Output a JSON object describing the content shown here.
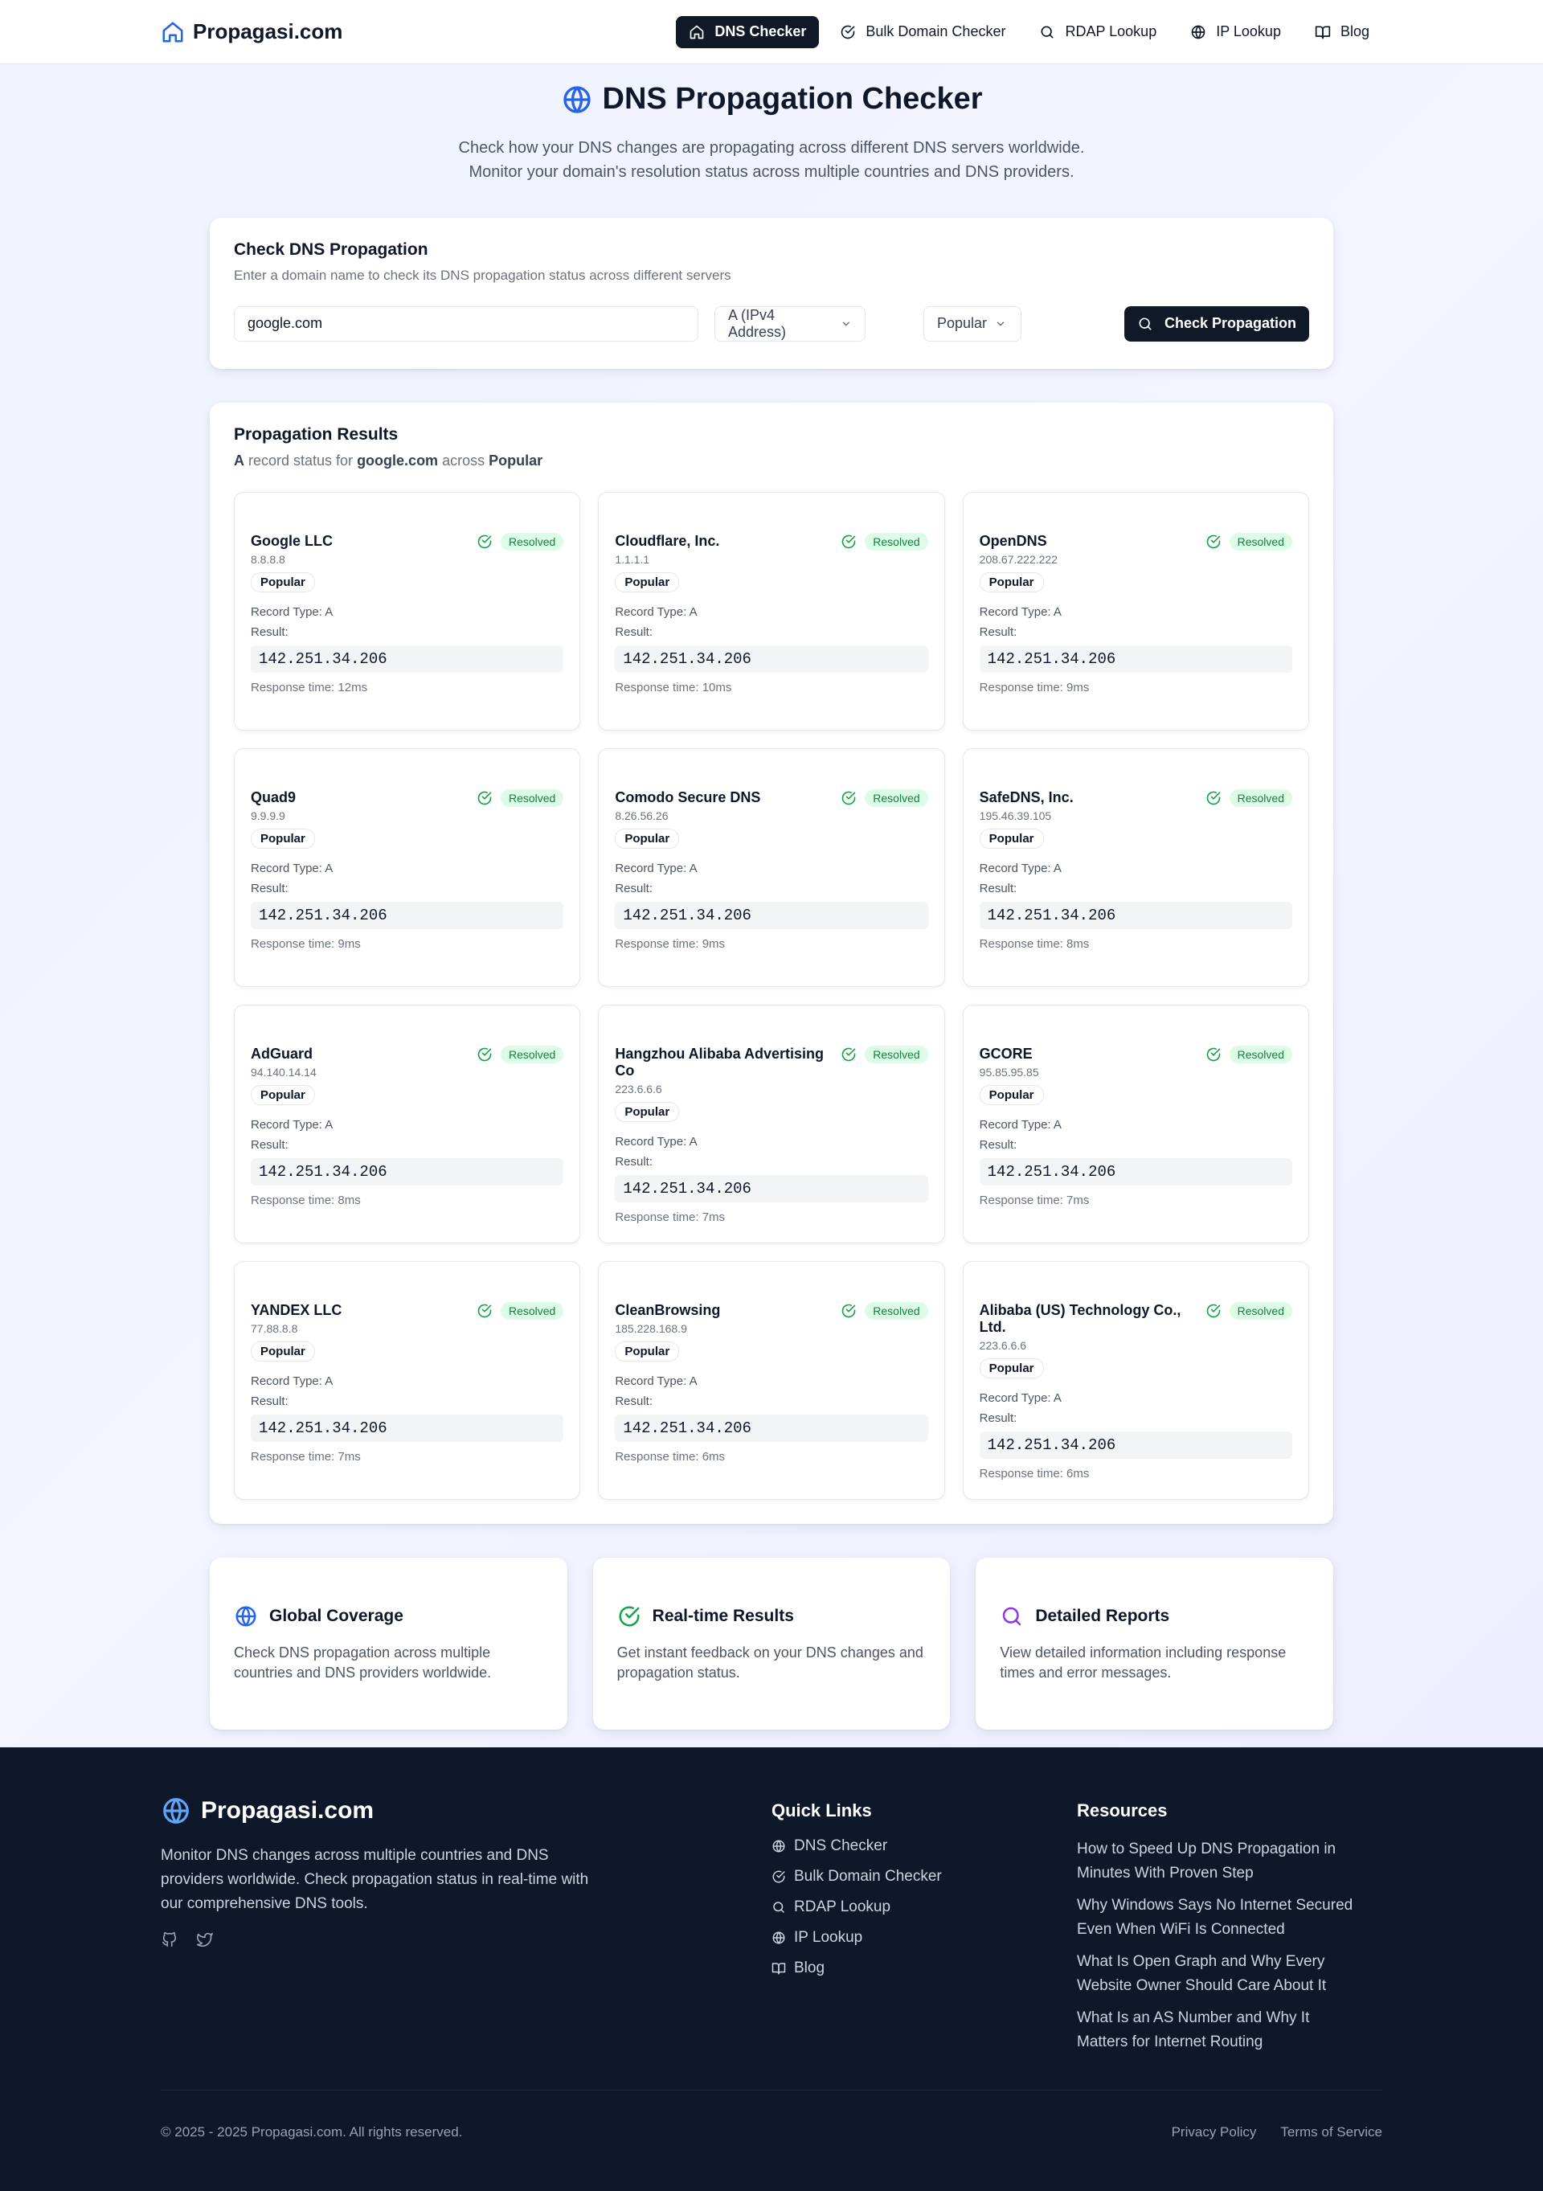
{
  "brand": {
    "name": "Propagasi.com"
  },
  "nav": {
    "items": [
      {
        "label": "DNS Checker",
        "icon": "home-icon",
        "active": true
      },
      {
        "label": "Bulk Domain Checker",
        "icon": "check-circle-icon"
      },
      {
        "label": "RDAP Lookup",
        "icon": "search-icon"
      },
      {
        "label": "IP Lookup",
        "icon": "globe-icon"
      },
      {
        "label": "Blog",
        "icon": "book-icon"
      }
    ]
  },
  "hero": {
    "title": "DNS Propagation Checker",
    "subtitle_line1": "Check how your DNS changes are propagating across different DNS servers worldwide.",
    "subtitle_line2": "Monitor your domain's resolution status across multiple countries and DNS providers."
  },
  "check": {
    "title": "Check DNS Propagation",
    "subtitle": "Enter a domain name to check its DNS propagation status across different servers",
    "domain_value": "google.com",
    "record_type": "A (IPv4 Address)",
    "region": "Popular",
    "button_label": "Check Propagation"
  },
  "results": {
    "title": "Propagation Results",
    "sub_record": "A",
    "sub_text1": " record status for ",
    "sub_domain": "google.com",
    "sub_text2": " across ",
    "sub_region": "Popular",
    "servers": [
      {
        "name": "Google LLC",
        "ip": "8.8.8.8",
        "status": "Resolved",
        "category": "Popular",
        "record_type": "Record Type: A",
        "result_label": "Result:",
        "result": "142.251.34.206",
        "response": "Response time: 12ms"
      },
      {
        "name": "Cloudflare, Inc.",
        "ip": "1.1.1.1",
        "status": "Resolved",
        "category": "Popular",
        "record_type": "Record Type: A",
        "result_label": "Result:",
        "result": "142.251.34.206",
        "response": "Response time: 10ms"
      },
      {
        "name": "OpenDNS",
        "ip": "208.67.222.222",
        "status": "Resolved",
        "category": "Popular",
        "record_type": "Record Type: A",
        "result_label": "Result:",
        "result": "142.251.34.206",
        "response": "Response time: 9ms"
      },
      {
        "name": "Quad9",
        "ip": "9.9.9.9",
        "status": "Resolved",
        "category": "Popular",
        "record_type": "Record Type: A",
        "result_label": "Result:",
        "result": "142.251.34.206",
        "response": "Response time: 9ms"
      },
      {
        "name": "Comodo Secure DNS",
        "ip": "8.26.56.26",
        "status": "Resolved",
        "category": "Popular",
        "record_type": "Record Type: A",
        "result_label": "Result:",
        "result": "142.251.34.206",
        "response": "Response time: 9ms"
      },
      {
        "name": "SafeDNS, Inc.",
        "ip": "195.46.39.105",
        "status": "Resolved",
        "category": "Popular",
        "record_type": "Record Type: A",
        "result_label": "Result:",
        "result": "142.251.34.206",
        "response": "Response time: 8ms"
      },
      {
        "name": "AdGuard",
        "ip": "94.140.14.14",
        "status": "Resolved",
        "category": "Popular",
        "record_type": "Record Type: A",
        "result_label": "Result:",
        "result": "142.251.34.206",
        "response": "Response time: 8ms"
      },
      {
        "name": "Hangzhou Alibaba Advertising Co",
        "ip": "223.6.6.6",
        "status": "Resolved",
        "category": "Popular",
        "record_type": "Record Type: A",
        "result_label": "Result:",
        "result": "142.251.34.206",
        "response": "Response time: 7ms"
      },
      {
        "name": "GCORE",
        "ip": "95.85.95.85",
        "status": "Resolved",
        "category": "Popular",
        "record_type": "Record Type: A",
        "result_label": "Result:",
        "result": "142.251.34.206",
        "response": "Response time: 7ms"
      },
      {
        "name": "YANDEX LLC",
        "ip": "77.88.8.8",
        "status": "Resolved",
        "category": "Popular",
        "record_type": "Record Type: A",
        "result_label": "Result:",
        "result": "142.251.34.206",
        "response": "Response time: 7ms"
      },
      {
        "name": "CleanBrowsing",
        "ip": "185.228.168.9",
        "status": "Resolved",
        "category": "Popular",
        "record_type": "Record Type: A",
        "result_label": "Result:",
        "result": "142.251.34.206",
        "response": "Response time: 6ms"
      },
      {
        "name": "Alibaba (US) Technology Co., Ltd.",
        "ip": "223.6.6.6",
        "status": "Resolved",
        "category": "Popular",
        "record_type": "Record Type: A",
        "result_label": "Result:",
        "result": "142.251.34.206",
        "response": "Response time: 6ms"
      }
    ]
  },
  "features": [
    {
      "title": "Global Coverage",
      "desc": "Check DNS propagation across multiple countries and DNS providers worldwide.",
      "icon": "globe-icon",
      "color": "#2563eb"
    },
    {
      "title": "Real-time Results",
      "desc": "Get instant feedback on your DNS changes and propagation status.",
      "icon": "check-circle-icon",
      "color": "#16a34a"
    },
    {
      "title": "Detailed Reports",
      "desc": "View detailed information including response times and error messages.",
      "icon": "search-icon",
      "color": "#9333ea"
    }
  ],
  "footer": {
    "brand": "Propagasi.com",
    "desc": "Monitor DNS changes across multiple countries and DNS providers worldwide. Check propagation status in real-time with our comprehensive DNS tools.",
    "quick_links_title": "Quick Links",
    "quick_links": [
      {
        "label": "DNS Checker",
        "icon": "globe-icon"
      },
      {
        "label": "Bulk Domain Checker",
        "icon": "check-circle-icon"
      },
      {
        "label": "RDAP Lookup",
        "icon": "search-icon"
      },
      {
        "label": "IP Lookup",
        "icon": "globe-icon"
      },
      {
        "label": "Blog",
        "icon": "book-icon"
      }
    ],
    "resources_title": "Resources",
    "resources": [
      "How to Speed Up DNS Propagation in Minutes With Proven Step",
      "Why Windows Says No Internet Secured Even When WiFi Is Connected",
      "What Is Open Graph and Why Every Website Owner Should Care About It",
      "What Is an AS Number and Why It Matters for Internet Routing"
    ],
    "copyright": "© 2025 - 2025 Propagasi.com. All rights reserved.",
    "privacy": "Privacy Policy",
    "terms": "Terms of Service"
  },
  "colors": {
    "accent": "#2563eb",
    "dark": "#111827",
    "resolved_bg": "#dcfce7",
    "resolved_text": "#15803d",
    "footer_bg": "#0f172a"
  }
}
